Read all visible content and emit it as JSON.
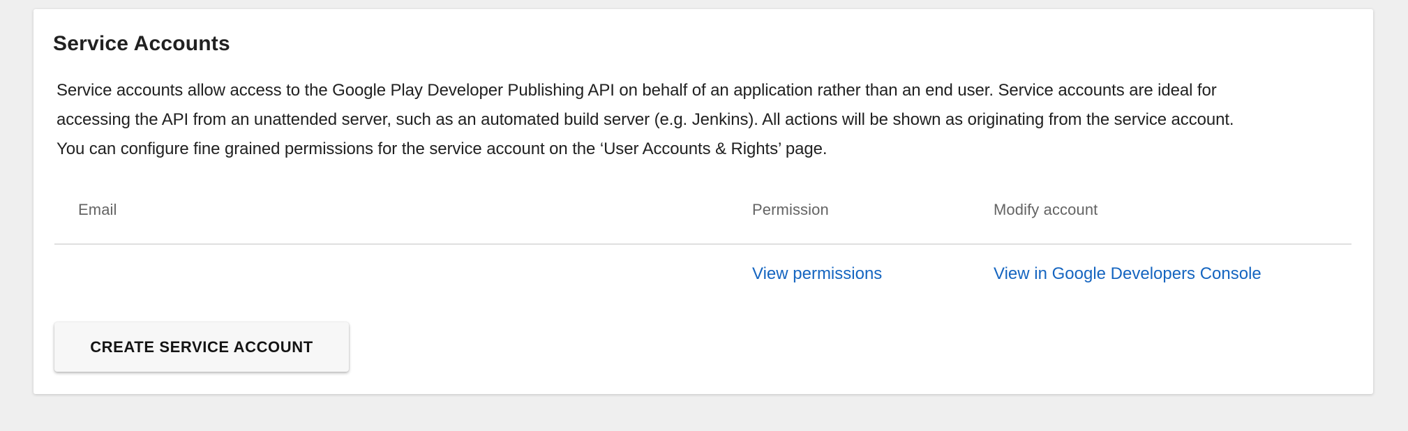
{
  "card": {
    "title": "Service Accounts",
    "description_lines": [
      "Service accounts allow access to the Google Play Developer Publishing API on behalf of an application rather than an end user. Service accounts are ideal for",
      "accessing the API from an unattended server, such as an automated build server (e.g. Jenkins). All actions will be shown as originating from the service account.",
      "You can configure fine grained permissions for the service account on the ‘User Accounts & Rights’ page."
    ],
    "table": {
      "columns": [
        "Email",
        "Permission",
        "Modify account"
      ],
      "row": {
        "email": "",
        "permission_link": "View permissions",
        "modify_link": "View in Google Developers Console"
      }
    },
    "create_button_label": "CREATE SERVICE ACCOUNT",
    "colors": {
      "page_background": "#efefef",
      "card_background": "#ffffff",
      "text_dark": "#212121",
      "header_gray": "#646464",
      "link_blue": "#1565c0",
      "divider_gray": "#dfdfdf"
    }
  }
}
